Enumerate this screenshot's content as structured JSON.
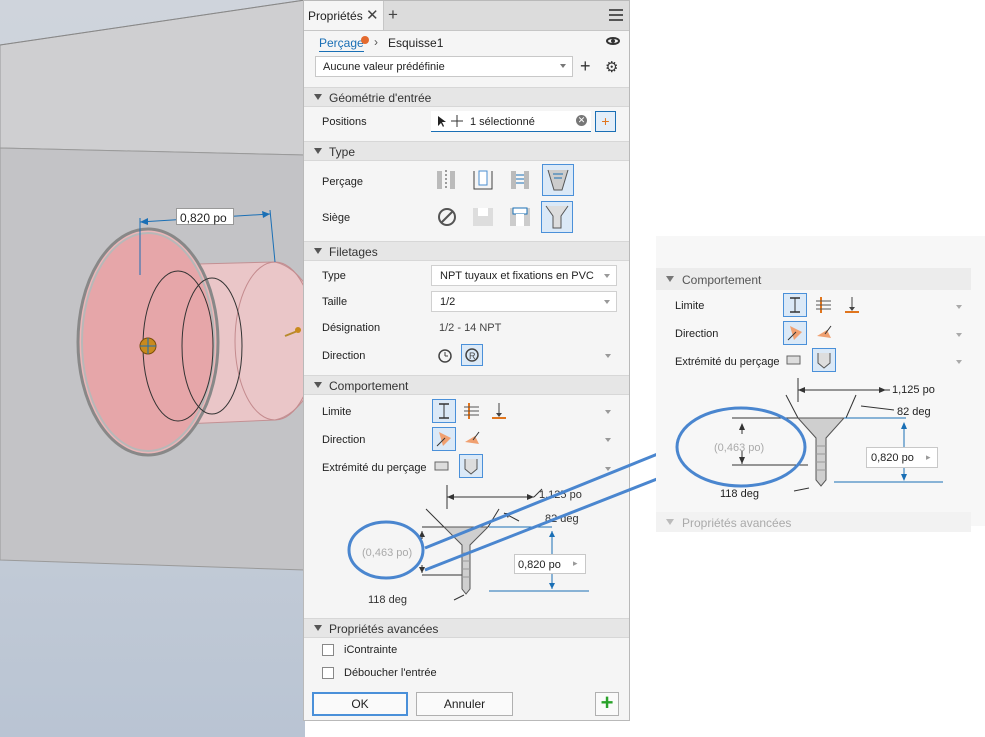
{
  "viewport": {
    "dimension_label": "0,820 po"
  },
  "panel": {
    "tab_label": "Propriétés",
    "breadcrumb": {
      "feature": "Perçage",
      "sketch": "Esquisse1"
    },
    "preset_value": "Aucune valeur prédéfinie",
    "sections": {
      "input_geometry": "Géométrie d'entrée",
      "type": "Type",
      "threads": "Filetages",
      "behavior": "Comportement",
      "advanced": "Propriétés avancées"
    },
    "input_geometry": {
      "positions_label": "Positions",
      "positions_value": "1 sélectionné"
    },
    "type": {
      "hole_label": "Perçage",
      "seat_label": "Siège"
    },
    "threads": {
      "type_label": "Type",
      "type_value": "NPT tuyaux et fixations en PVC",
      "size_label": "Taille",
      "size_value": "1/2",
      "designation_label": "Désignation",
      "designation_value": "1/2 - 14 NPT",
      "direction_label": "Direction"
    },
    "behavior": {
      "limit_label": "Limite",
      "direction_label": "Direction",
      "end_label": "Extrémité du perçage",
      "dim_depth": "1,125 po",
      "dim_angle": "82 deg",
      "dim_countersink": "(0,463 po)",
      "dim_length": "0,820 po",
      "dim_tip": "118 deg"
    },
    "advanced": {
      "option1": "iContrainte",
      "option2": "Déboucher l'entrée"
    },
    "buttons": {
      "ok": "OK",
      "cancel": "Annuler"
    }
  },
  "zoom": {
    "section_behavior": "Comportement",
    "limit_label": "Limite",
    "direction_label": "Direction",
    "end_label": "Extrémité du perçage",
    "dim_depth": "1,125 po",
    "dim_angle": "82 deg",
    "dim_countersink": "(0,463 po)",
    "dim_length": "0,820 po",
    "dim_tip": "118 deg",
    "section_advanced": "Propriétés avancées"
  },
  "colors": {
    "accent": "#1a6fb5",
    "highlight_circle": "#4a86cf",
    "model_pink": "#e8b4b6",
    "apply_green": "#2aa22a"
  }
}
